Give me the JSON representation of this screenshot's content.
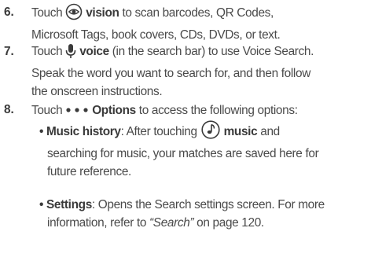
{
  "steps": [
    {
      "num": "6.",
      "line1_pre": "Touch ",
      "line1_icon": "vision-eye-icon",
      "line1_bold": "vision",
      "line1_post": " to scan barcodes, QR Codes,",
      "line2": "Microsoft Tags, book covers, CDs, DVDs, or text."
    },
    {
      "num": "7.",
      "line1_pre": "Touch ",
      "line1_icon": "microphone-icon",
      "line1_bold": "voice",
      "line1_post": " (in the search bar) to use Voice Search.",
      "line2": "Speak the word you want to search for, and then follow",
      "line3": "the onscreen instructions."
    },
    {
      "num": "8.",
      "line1_pre": "Touch ",
      "line1_icon": "options-dots-icon",
      "line1_bold": "Options",
      "line1_post": " to access the following options:",
      "bullets": [
        {
          "marker": "•",
          "term": "Music history",
          "line1_pre": ": After touching ",
          "line1_icon": "music-note-icon",
          "line1_bold": "music",
          "line1_post": " and",
          "line2": "searching for music, your matches are saved here for",
          "line3": "future reference."
        },
        {
          "marker": "•",
          "term": "Settings",
          "line1_post": ": Opens the Search settings screen. For more",
          "line2_pre": "information, refer to ",
          "line2_ref": "“Search”",
          "line2_post": " on page 120."
        }
      ]
    }
  ],
  "colors": {
    "text": "#4a4a4a",
    "bold": "#3a3a3a"
  }
}
